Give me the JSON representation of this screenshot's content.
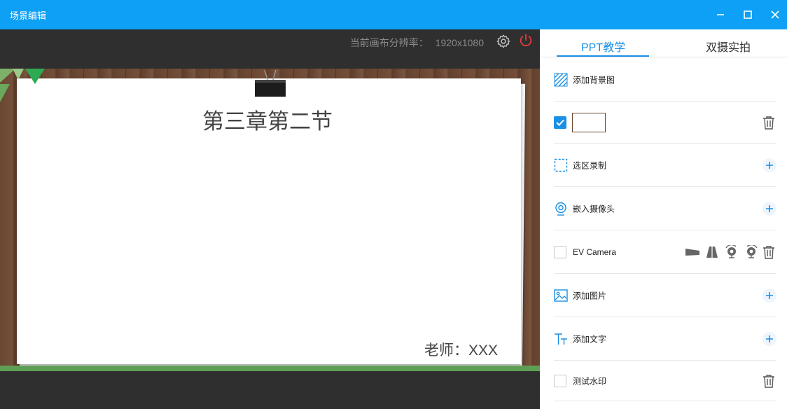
{
  "window": {
    "title": "场景编辑"
  },
  "canvas": {
    "resolution_label": "当前画布分辨率：",
    "resolution_value": "1920x1080"
  },
  "slide": {
    "title": "第三章第二节",
    "teacher": "老师：XXX"
  },
  "tabs": [
    {
      "label": "PPT教学",
      "active": true
    },
    {
      "label": "双摄实拍",
      "active": false
    }
  ],
  "panel": {
    "add_background": "添加背景图",
    "select_record": "选区录制",
    "embed_camera": "嵌入摄像头",
    "ev_camera": "EV Camera",
    "add_image": "添加图片",
    "add_text": "添加文字",
    "watermark": "测试水印"
  },
  "colors": {
    "titlebar": "#0ea0f5",
    "accent": "#1a8fe6",
    "power": "#e23a3a"
  }
}
